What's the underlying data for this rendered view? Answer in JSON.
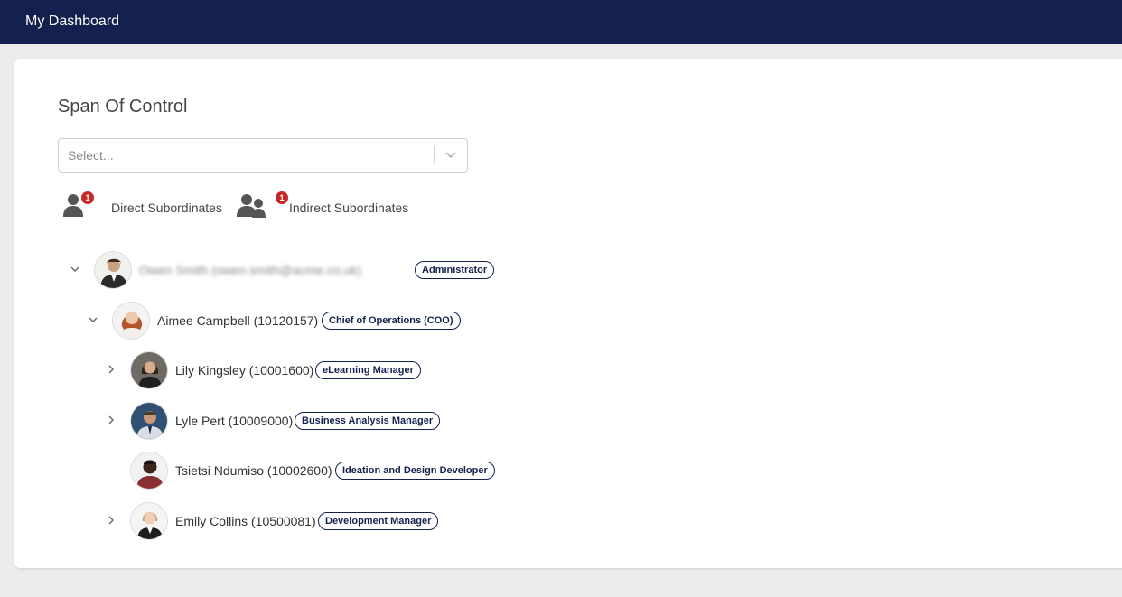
{
  "app": {
    "title": "My Dashboard"
  },
  "page": {
    "title": "Span Of Control",
    "select": {
      "placeholder": "Select..."
    }
  },
  "legend": {
    "direct": {
      "label": "Direct Subordinates",
      "count": "1"
    },
    "indirect": {
      "label": "Indirect Subordinates",
      "count": "1"
    }
  },
  "tree": {
    "root": {
      "name": "Owen Smith (owen.smith@acme.co.uk)",
      "role": "Administrator",
      "expanded": true
    },
    "level1": {
      "name": "Aimee Campbell (10120157)",
      "role": "Chief of Operations (COO)",
      "expanded": true
    },
    "children": [
      {
        "name": "Lily Kingsley (10001600)",
        "role": "eLearning Manager",
        "has_children": true
      },
      {
        "name": "Lyle Pert (10009000)",
        "role": "Business Analysis Manager",
        "has_children": true
      },
      {
        "name": "Tsietsi Ndumiso (10002600)",
        "role": "Ideation and Design Developer",
        "has_children": false
      },
      {
        "name": "Emily Collins (10500081)",
        "role": "Development Manager",
        "has_children": true
      }
    ]
  },
  "colors": {
    "navy": "#14214f",
    "badge_red": "#c62828",
    "background": "#ececec"
  }
}
